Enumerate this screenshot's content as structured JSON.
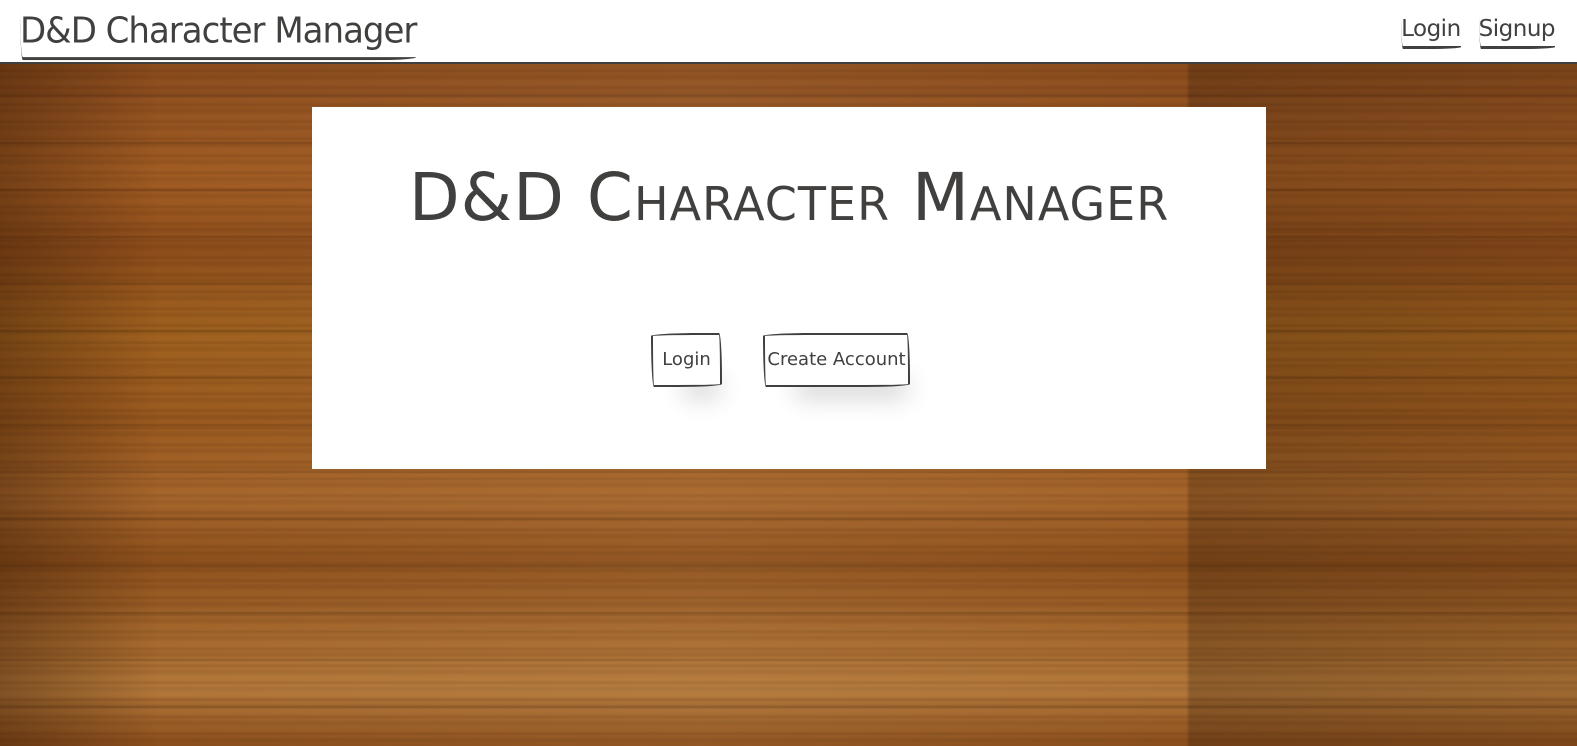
{
  "navbar": {
    "brand": "D&D Character Manager",
    "links": [
      {
        "label": "Login"
      },
      {
        "label": "Signup"
      }
    ]
  },
  "hero": {
    "title": "D&D Character Manager",
    "buttons": {
      "login": "Login",
      "create_account": "Create Account"
    }
  },
  "colors": {
    "ink": "#41403e",
    "card_background": "#ffffff",
    "page_background": "#8a4e1c"
  }
}
